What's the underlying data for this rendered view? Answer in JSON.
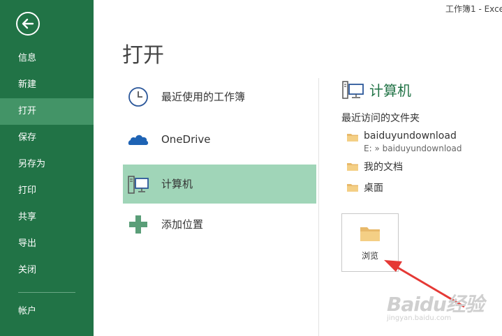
{
  "window": {
    "title": "工作簿1 - Exce"
  },
  "nav": {
    "items": [
      {
        "label": "信息"
      },
      {
        "label": "新建"
      },
      {
        "label": "打开"
      },
      {
        "label": "保存"
      },
      {
        "label": "另存为"
      },
      {
        "label": "打印"
      },
      {
        "label": "共享"
      },
      {
        "label": "导出"
      },
      {
        "label": "关闭"
      },
      {
        "label": "帐户"
      }
    ],
    "active": "打开"
  },
  "page": {
    "title": "打开"
  },
  "places": [
    {
      "label": "最近使用的工作簿",
      "icon": "clock-icon"
    },
    {
      "label": "OneDrive",
      "icon": "onedrive-cloud-icon"
    },
    {
      "label": "计算机",
      "icon": "computer-icon"
    },
    {
      "label": "添加位置",
      "icon": "plus-icon"
    }
  ],
  "right": {
    "heading": "计算机",
    "recent_label": "最近访问的文件夹",
    "recent_folders": [
      {
        "name": "baiduyundownload",
        "path": "E: » baiduyundownload"
      },
      {
        "name": "我的文档"
      },
      {
        "name": "桌面"
      }
    ],
    "browse_label": "浏览"
  },
  "watermark": {
    "logo": "Baidu经验",
    "url": "jingyan.baidu.com"
  },
  "colors": {
    "brand": "#217346",
    "nav_active": "#439467",
    "place_active": "#a0d5b8",
    "annotation_arrow": "#e53935"
  }
}
